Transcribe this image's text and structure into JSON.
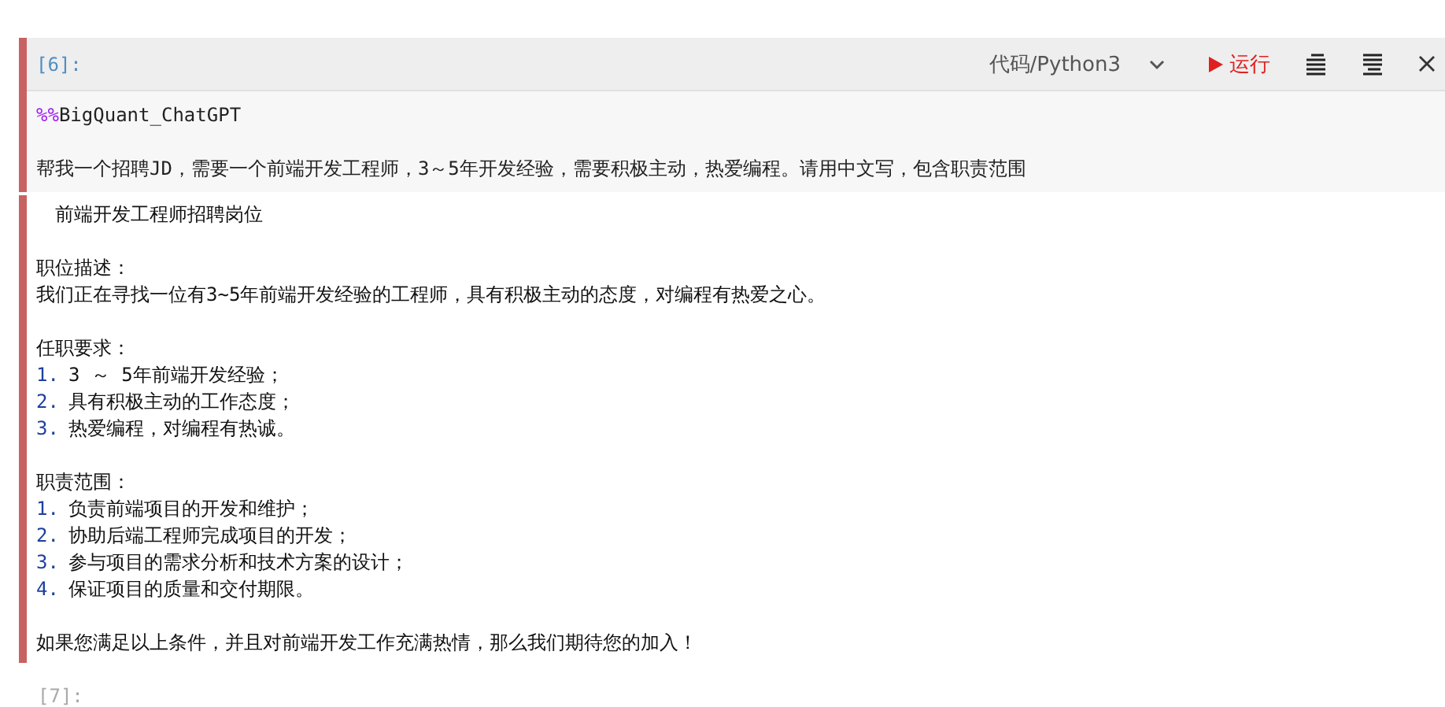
{
  "cell": {
    "prompt": "[6]:",
    "kernel": "代码/Python3",
    "run_label": "运行",
    "input": {
      "magic_prefix": "%%",
      "magic_name": "BigQuant_ChatGPT",
      "prompt_text": "帮我一个招聘JD，需要一个前端开发工程师，3～5年开发经验，需要积极主动，热爱编程。请用中文写，包含职责范围"
    },
    "output": {
      "title": "前端开发工程师招聘岗位",
      "sections": [
        {
          "heading": "职位描述：",
          "lines": [
            {
              "text": "我们正在寻找一位有3~5年前端开发经验的工程师，具有积极主动的态度，对编程有热爱之心。"
            }
          ]
        },
        {
          "heading": "任职要求：",
          "lines": [
            {
              "number": "1.",
              "text": "3 ～ 5年前端开发经验；"
            },
            {
              "number": "2.",
              "text": "具有积极主动的工作态度；"
            },
            {
              "number": "3.",
              "text": "热爱编程，对编程有热诚。"
            }
          ]
        },
        {
          "heading": "职责范围：",
          "lines": [
            {
              "number": "1.",
              "text": "负责前端项目的开发和维护；"
            },
            {
              "number": "2.",
              "text": "协助后端工程师完成项目的开发；"
            },
            {
              "number": "3.",
              "text": "参与项目的需求分析和技术方案的设计；"
            },
            {
              "number": "4.",
              "text": "保证项目的质量和交付期限。"
            }
          ]
        }
      ],
      "closing": "如果您满足以上条件，并且对前端开发工作充满热情，那么我们期待您的加入！"
    }
  },
  "next_cell": {
    "prompt": "[7]:"
  }
}
